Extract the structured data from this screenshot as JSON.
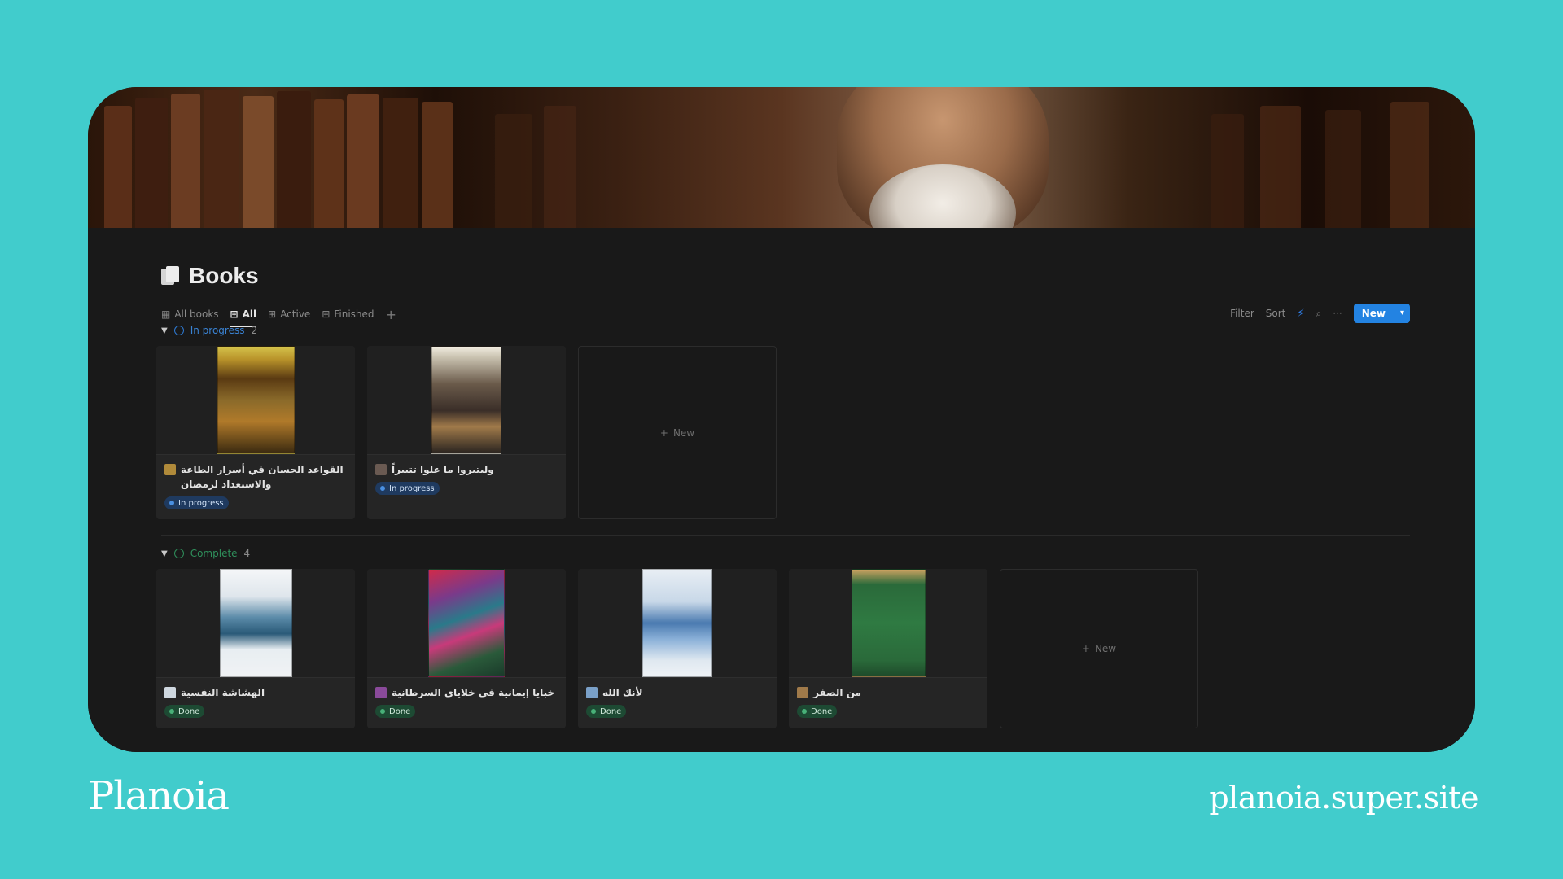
{
  "database": {
    "title": "Books"
  },
  "tabs": [
    {
      "label": "All books",
      "icon": "table-icon",
      "active": false
    },
    {
      "label": "All",
      "icon": "gallery-icon",
      "active": true
    },
    {
      "label": "Active",
      "icon": "gallery-icon",
      "active": false
    },
    {
      "label": "Finished",
      "icon": "gallery-icon",
      "active": false
    }
  ],
  "add_tab_symbol": "+",
  "toolbar": {
    "filter": "Filter",
    "sort": "Sort",
    "more_symbol": "···",
    "new_label": "New"
  },
  "groups": [
    {
      "label": "In progress",
      "count": "2",
      "status_color": "#2e7bd6",
      "cards": [
        {
          "title": "القواعد الحسان في أسرار الطاعة والاستعداد لرمضان",
          "status": "In progress"
        },
        {
          "title": "وليتبروا ما علوا تتبيراً",
          "status": "In progress"
        }
      ],
      "new_label": "New"
    },
    {
      "label": "Complete",
      "count": "4",
      "status_color": "#2f8f5b",
      "cards": [
        {
          "title": "الهشاشة النفسية",
          "status": "Done"
        },
        {
          "title": "خبايا إيمانية في خلاياي السرطانية",
          "status": "Done"
        },
        {
          "title": "لأنك الله",
          "status": "Done"
        },
        {
          "title": "من الصفر",
          "status": "Done"
        }
      ],
      "new_label": "New"
    }
  ],
  "brand": {
    "name": "Planoia",
    "site": "planoia.super.site"
  },
  "colors": {
    "background": "#41cccc",
    "accent": "#2383e2",
    "progress": "#4a90e2",
    "done": "#48b078"
  }
}
